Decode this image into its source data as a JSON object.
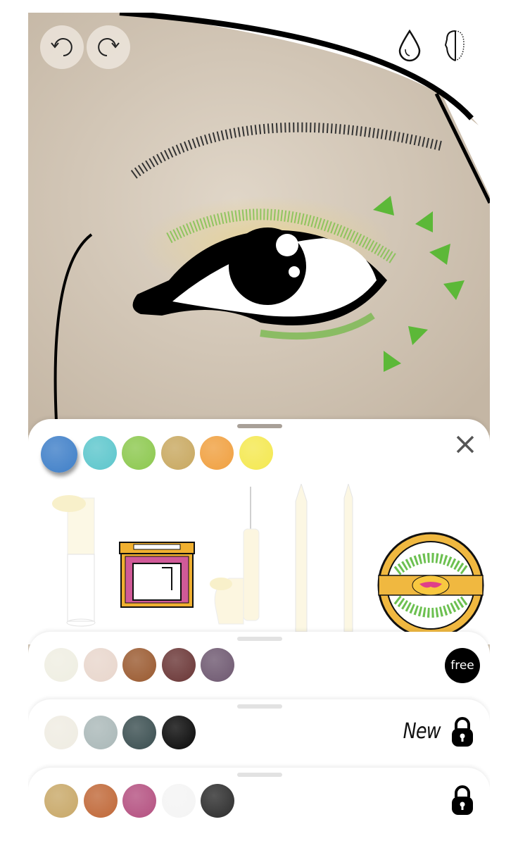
{
  "toolbar": {
    "undo": "undo-icon",
    "redo": "redo-icon",
    "blend": "drop-icon",
    "symmetry": "face-half-icon"
  },
  "main_palette": {
    "selected": 0,
    "colors": [
      "#3f7fc8",
      "#5cc6cc",
      "#8cc84e",
      "#c8a860",
      "#f0a040",
      "#f4e850"
    ]
  },
  "products": [
    "lip-gloss",
    "eyeshadow-palette",
    "liquid-eyeliner",
    "pencil-1",
    "pencil-2",
    "false-lashes-case"
  ],
  "close_icon": "close-icon",
  "palettes": [
    {
      "colors": [
        "#efeee2",
        "#e8d6cc",
        "#9a5a30",
        "#6a3636",
        "#6e5870"
      ],
      "badge": "free"
    },
    {
      "colors": [
        "#efece2",
        "#aab8b8",
        "#3a4e50",
        "#080808"
      ],
      "badge": "New",
      "locked": true
    },
    {
      "colors": [
        "#c8a868",
        "#c06838",
        "#b45080",
        "#f4f4f4",
        "#2c2c2c"
      ],
      "locked": true
    }
  ]
}
